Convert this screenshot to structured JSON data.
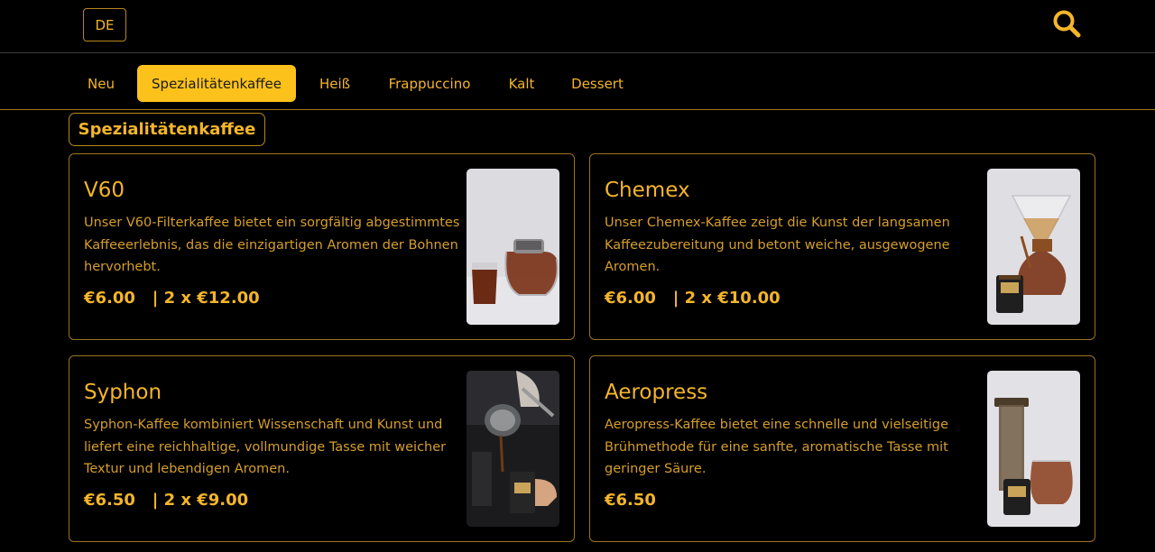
{
  "header": {
    "language_label": "DE",
    "search_icon": "search-icon"
  },
  "tabs": [
    {
      "label": "Neu",
      "active": false
    },
    {
      "label": "Spezialitätenkaffee",
      "active": true
    },
    {
      "label": "Heiß",
      "active": false
    },
    {
      "label": "Frappuccino",
      "active": false
    },
    {
      "label": "Kalt",
      "active": false
    },
    {
      "label": "Dessert",
      "active": false
    }
  ],
  "section": {
    "title": "Spezialitätenkaffee"
  },
  "products": [
    {
      "name": "V60",
      "description": "Unser V60-Filterkaffee bietet ein sorgfältig abgestimmtes Kaffeeerlebnis, das die einzigartigen Aromen der Bohnen hervorhebt.",
      "price": "€6.00   | 2 x €12.00"
    },
    {
      "name": "Chemex",
      "description": "Unser Chemex-Kaffee zeigt die Kunst der langsamen Kaffeezubereitung und betont weiche, ausgewogene Aromen.",
      "price": "€6.00   | 2 x €10.00"
    },
    {
      "name": "Syphon",
      "description": "Syphon-Kaffee kombiniert Wissenschaft und Kunst und liefert eine reichhaltige, vollmundige Tasse mit weicher Textur und lebendigen Aromen.",
      "price": "€6.50   | 2 x €9.00"
    },
    {
      "name": "Aeropress",
      "description": "Aeropress-Kaffee bietet eine schnelle und vielseitige Brühmethode für eine sanfte, aromatische Tasse mit geringer Säure.",
      "price": "€6.50"
    }
  ],
  "colors": {
    "accent": "#f4b52a",
    "active_tab_bg": "#fcc21b",
    "background": "#000000",
    "border": "#9c7322"
  }
}
